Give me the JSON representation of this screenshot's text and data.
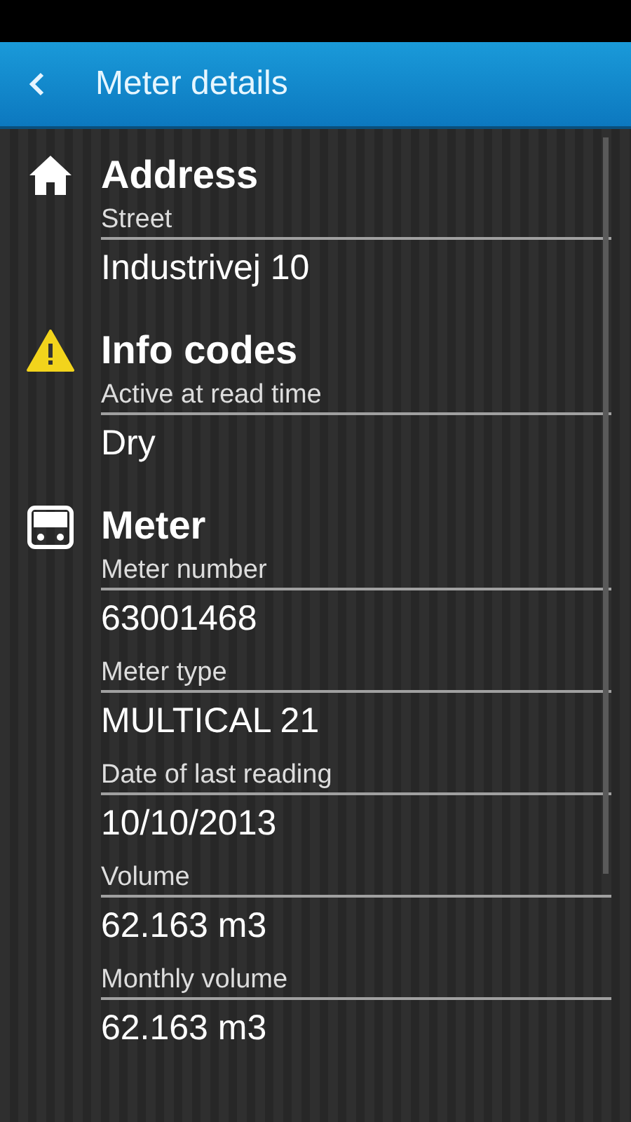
{
  "header": {
    "title": "Meter details"
  },
  "sections": [
    {
      "kind": "home",
      "title": "Address",
      "fields": [
        {
          "label": "Street",
          "value": "Industrivej 10"
        }
      ]
    },
    {
      "kind": "warning",
      "title": "Info codes",
      "fields": [
        {
          "label": "Active at read time",
          "value": "Dry"
        }
      ]
    },
    {
      "kind": "meter",
      "title": "Meter",
      "fields": [
        {
          "label": "Meter number",
          "value": "63001468"
        },
        {
          "label": "Meter type",
          "value": "MULTICAL 21"
        },
        {
          "label": "Date of last reading",
          "value": "10/10/2013"
        },
        {
          "label": "Volume",
          "value": "62.163 m3"
        },
        {
          "label": "Monthly volume",
          "value": "62.163 m3"
        }
      ]
    }
  ]
}
